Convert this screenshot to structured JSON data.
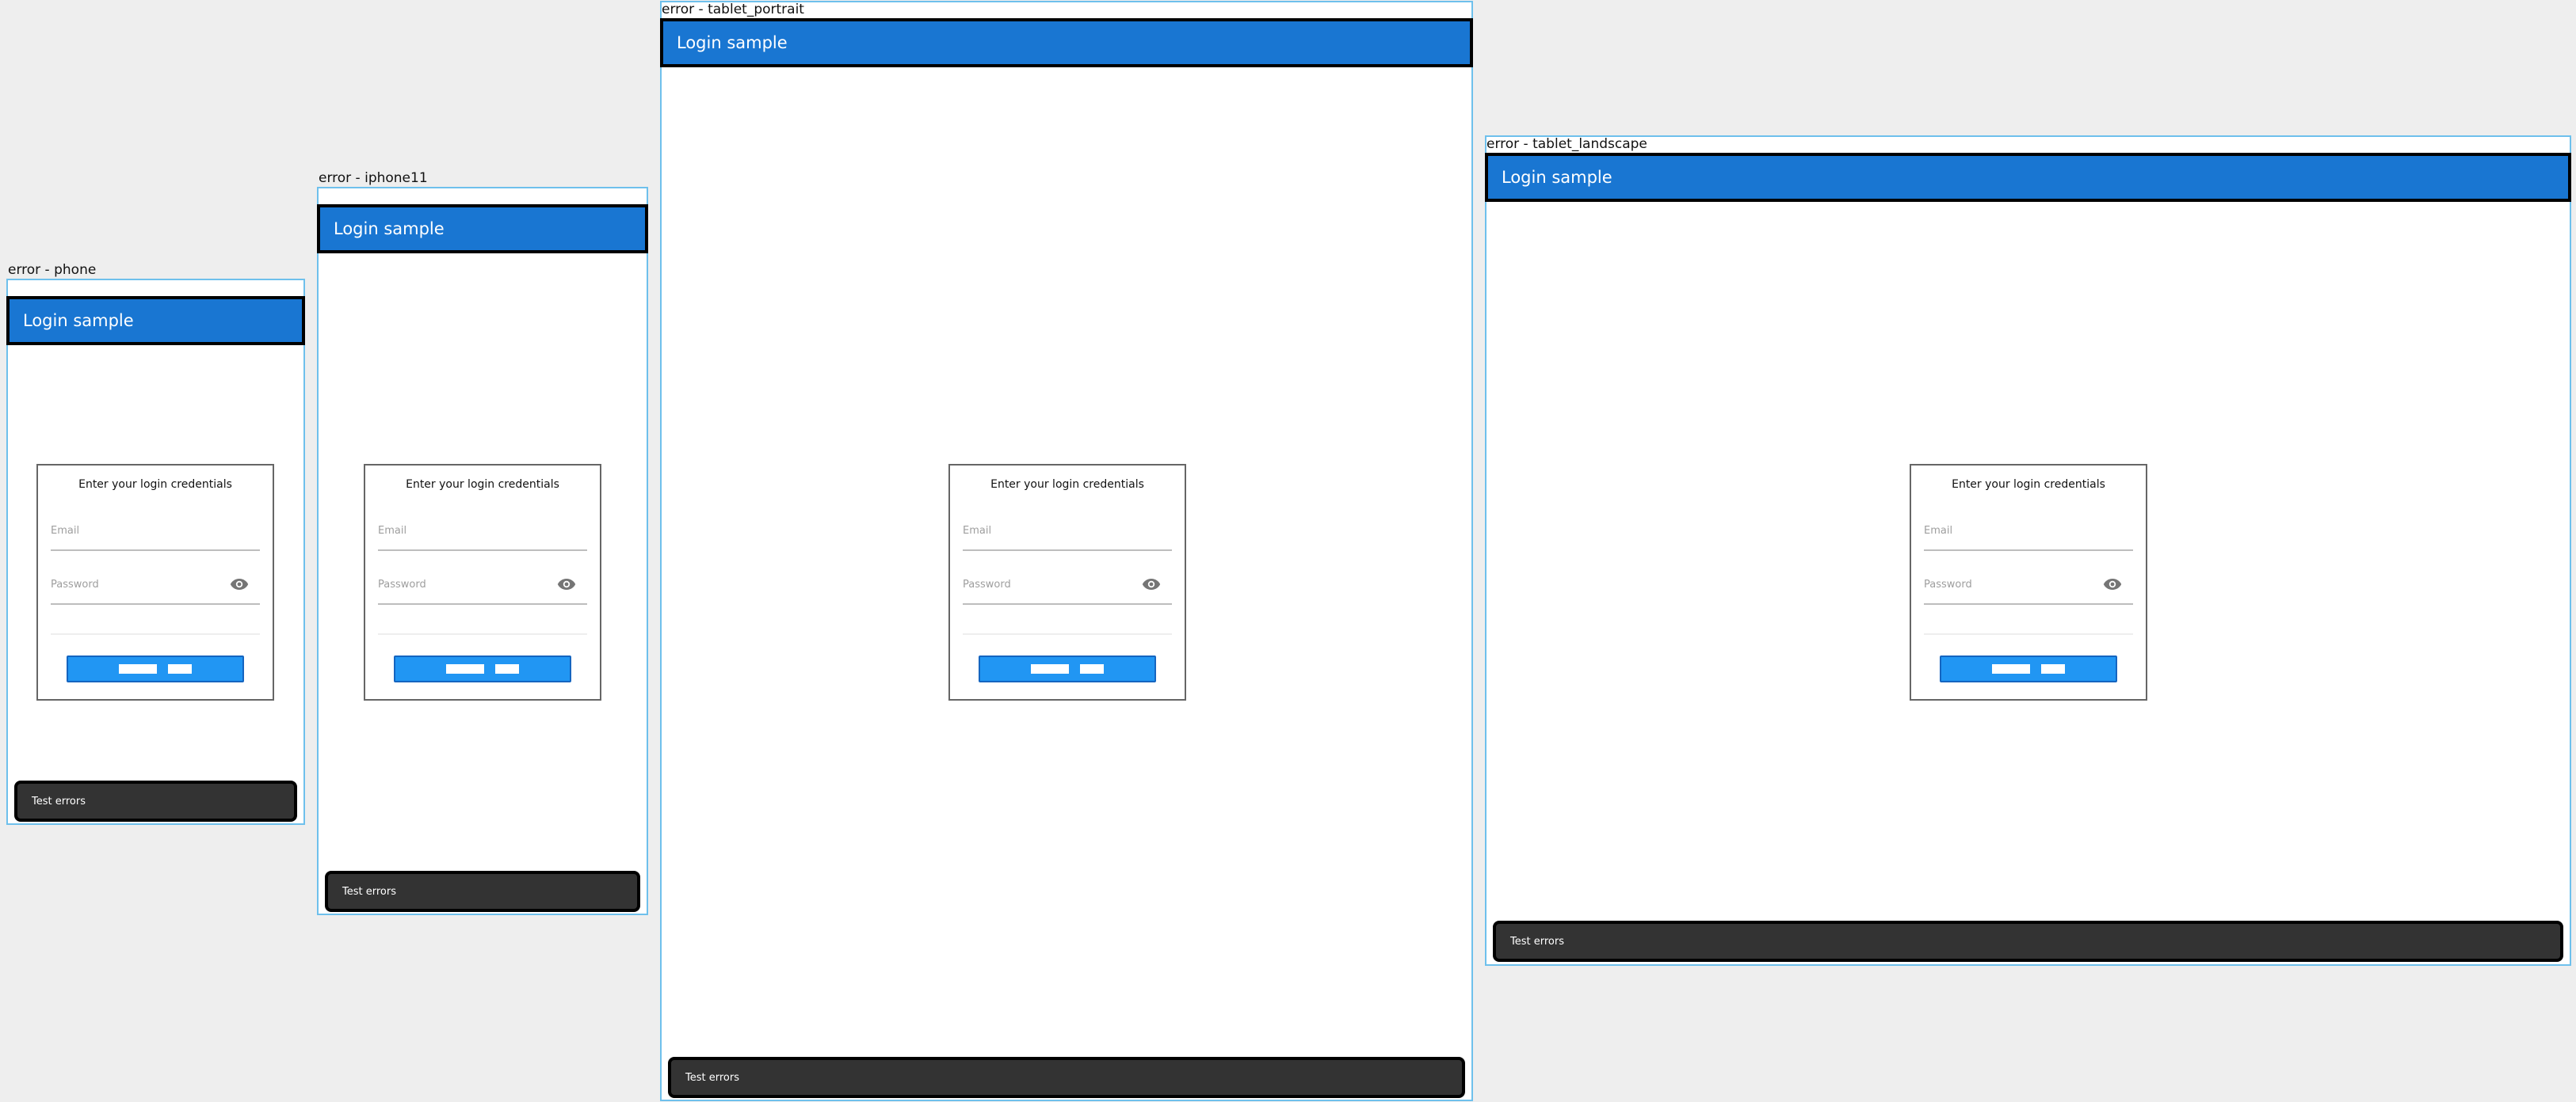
{
  "app": {
    "title": "Login sample",
    "card_title": "Enter your login credentials",
    "email_placeholder": "Email",
    "password_placeholder": "Password",
    "snackbar_text": "Test errors"
  },
  "devices": [
    {
      "label": "error - phone"
    },
    {
      "label": "error - iphone11"
    },
    {
      "label": "error - tablet_portrait"
    },
    {
      "label": "error - tablet_landscape"
    }
  ],
  "colors": {
    "app_bar": "#1976d2",
    "primary_button": "#2196f3",
    "snackbar": "#333333",
    "device_outline": "#6ec0ec",
    "canvas": "#eeeeee"
  },
  "icons": {
    "password_toggle": "eye-icon"
  }
}
